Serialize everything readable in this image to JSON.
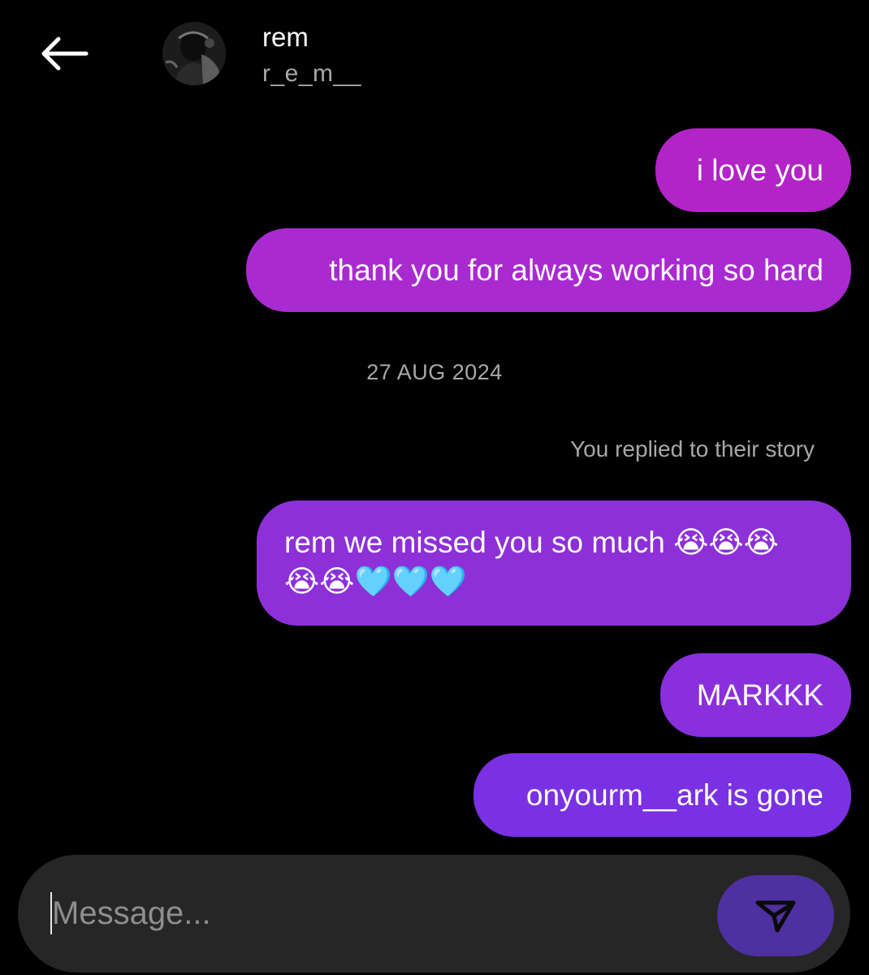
{
  "header": {
    "name": "rem",
    "username": "r_e_m__"
  },
  "messages": [
    {
      "text": "i love you",
      "color": "#b224c6"
    },
    {
      "text": "thank you for always working so hard",
      "color": "#a92ad0"
    },
    {
      "text_line1": "rem we missed you so much 😭😭😭",
      "text_line2": "😭😭🩵🩵🩵",
      "color": "#8d30d8"
    },
    {
      "text": "MARKKK",
      "color": "#8a2fdc"
    },
    {
      "text": "onyourm__ark is gone",
      "color": "#7a30e3"
    }
  ],
  "date_separator": "27 AUG 2024",
  "story_reply_note": "You replied to their story",
  "composer": {
    "placeholder": "Message...",
    "send_icon": "send-arrow-icon",
    "send_color": "#4e30a0"
  },
  "icons": {
    "back": "arrow-left-icon"
  }
}
